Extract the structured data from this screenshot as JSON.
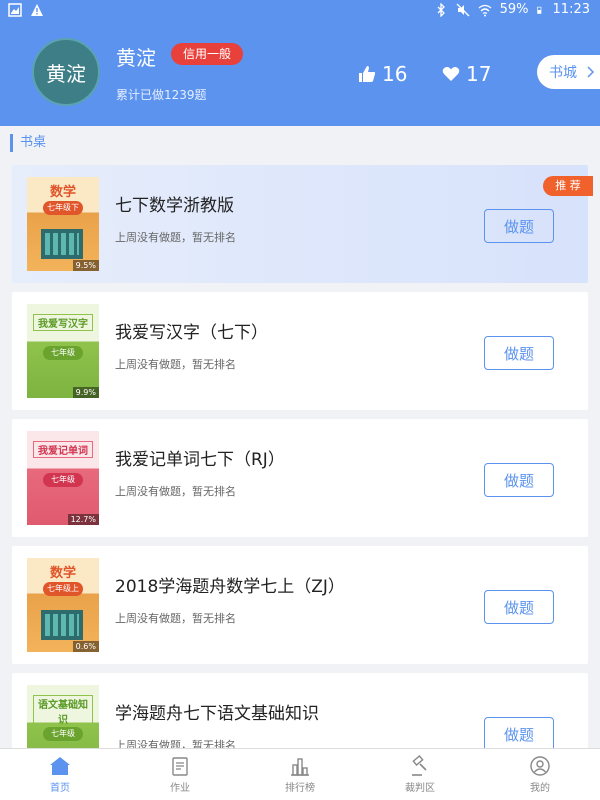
{
  "status_bar": {
    "battery": "59%",
    "time": "11:23"
  },
  "user": {
    "name": "黄淀",
    "avatar_text": "黄淀",
    "credit_badge": "信用一般",
    "done_text": "累计已做1239题",
    "likes": "16",
    "hearts": "17"
  },
  "mall_button": "书城",
  "section_title": "书桌",
  "books": [
    {
      "title": "七下数学浙教版",
      "subtitle": "上周没有做题，暂无排名",
      "button": "做题",
      "badge": "推 荐",
      "cover_subject": "数学",
      "cover_grade": "七年级下",
      "cover_percent": "9.5%"
    },
    {
      "title": "我爱写汉字（七下）",
      "subtitle": "上周没有做题，暂无排名",
      "button": "做题",
      "cover_subject": "我爱写汉字",
      "cover_grade": "七年级 ",
      "cover_percent": "9.9%"
    },
    {
      "title": "我爱记单词七下（RJ）",
      "subtitle": "上周没有做题，暂无排名",
      "button": "做题",
      "cover_subject": "我爱记单词",
      "cover_grade": "七年级 ",
      "cover_percent": "12.7%"
    },
    {
      "title": "2018学海题舟数学七上（ZJ）",
      "subtitle": "上周没有做题，暂无排名",
      "button": "做题",
      "cover_subject": "数学",
      "cover_grade": "七年级上",
      "cover_percent": "0.6%"
    },
    {
      "title": "学海题舟七下语文基础知识",
      "subtitle": "上周没有做题，暂无排名",
      "button": "做题",
      "cover_subject": "语文基础知识",
      "cover_grade": "七年级 "
    }
  ],
  "tabs": [
    {
      "label": "首页",
      "icon": "home-icon",
      "active": true
    },
    {
      "label": "作业",
      "icon": "homework-icon"
    },
    {
      "label": "排行榜",
      "icon": "ranking-icon"
    },
    {
      "label": "裁判区",
      "icon": "judge-icon"
    },
    {
      "label": "我的",
      "icon": "profile-icon"
    }
  ],
  "colors": {
    "primary": "#5b93ee",
    "credit": "#e8413c",
    "recommend": "#f0612c"
  }
}
